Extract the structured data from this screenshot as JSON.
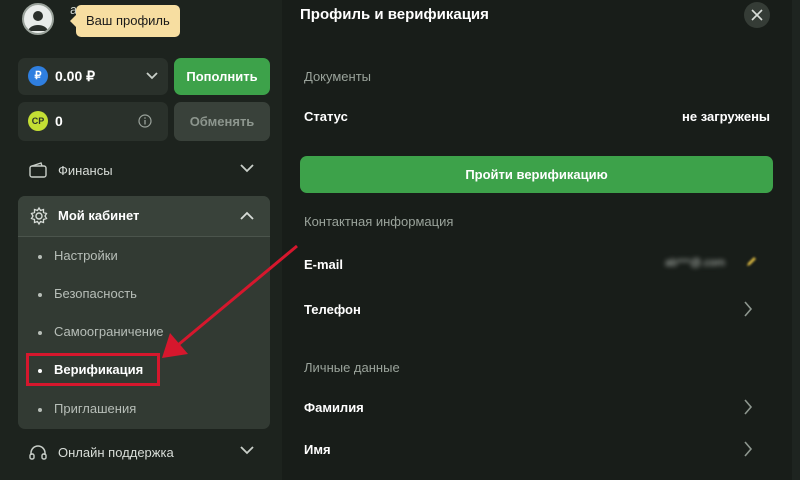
{
  "profile": {
    "initial": "а",
    "tooltip": "Ваш профиль"
  },
  "balance": {
    "amount": "0.00 ₽",
    "currency_symbol": "₽",
    "deposit_label": "Пополнить"
  },
  "points": {
    "symbol": "CP",
    "amount": "0",
    "exchange_label": "Обменять"
  },
  "sidebar": {
    "finance_label": "Финансы",
    "cabinet": {
      "label": "Мой кабинет",
      "items": [
        {
          "label": "Настройки"
        },
        {
          "label": "Безопасность"
        },
        {
          "label": "Самоограничение"
        },
        {
          "label": "Верификация",
          "active": true
        },
        {
          "label": "Приглашения"
        }
      ]
    },
    "support_label": "Онлайн поддержка"
  },
  "panel": {
    "title": "Профиль и верификация",
    "documents": {
      "title": "Документы",
      "status_label": "Статус",
      "status_value": "не загружены",
      "verify_button": "Пройти верификацию"
    },
    "contact": {
      "title": "Контактная информация",
      "email_label": "E-mail",
      "email_value": "ab***@.com",
      "phone_label": "Телефон"
    },
    "personal": {
      "title": "Личные данные",
      "lastname_label": "Фамилия",
      "firstname_label": "Имя"
    }
  },
  "colors": {
    "accent_green": "#3da24a",
    "highlight_red": "#d6172d",
    "tooltip_bg": "#f7dea1"
  }
}
